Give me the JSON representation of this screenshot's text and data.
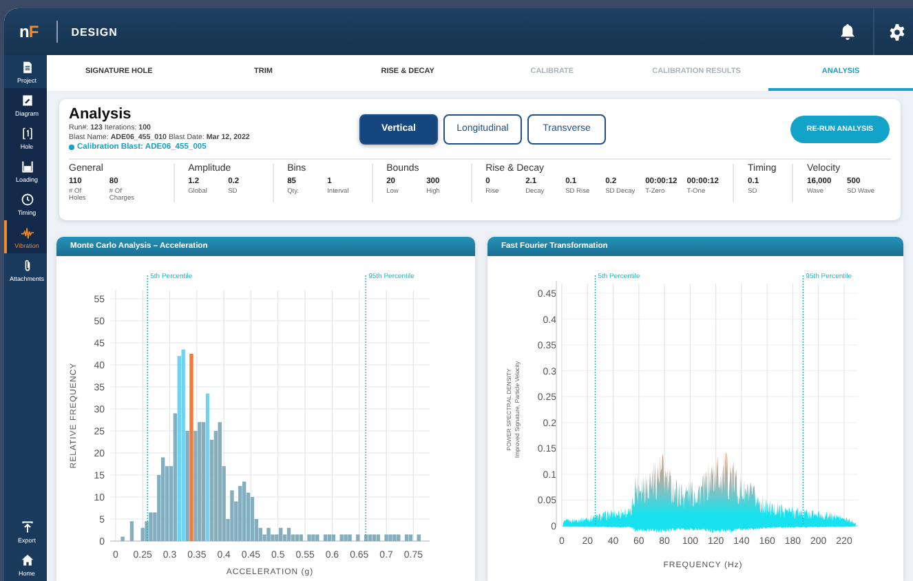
{
  "header": {
    "logo_left": "n",
    "logo_right": "F",
    "title": "DESIGN"
  },
  "sidebar": {
    "items": [
      {
        "label": "Project",
        "kind": "section",
        "selected": false
      },
      {
        "label": "Diagram",
        "kind": "step",
        "selected": false
      },
      {
        "label": "Hole",
        "kind": "step",
        "selected": false
      },
      {
        "label": "Loading",
        "kind": "step",
        "selected": false
      },
      {
        "label": "Timing",
        "kind": "step",
        "selected": false
      },
      {
        "label": "Vibration",
        "kind": "step",
        "selected": true
      },
      {
        "label": "Attachments",
        "kind": "section",
        "selected": false
      }
    ],
    "footer_items": [
      {
        "label": "Export"
      },
      {
        "label": "Home"
      }
    ]
  },
  "tabs": [
    {
      "label": "SIGNATURE HOLE",
      "selected": false,
      "disabled": false
    },
    {
      "label": "TRIM",
      "selected": false,
      "disabled": false
    },
    {
      "label": "RISE & DECAY",
      "selected": false,
      "disabled": false
    },
    {
      "label": "CALIBRATE",
      "selected": false,
      "disabled": true
    },
    {
      "label": "CALIBRATION RESULTS",
      "selected": false,
      "disabled": true
    },
    {
      "label": "ANALYSIS",
      "selected": true,
      "disabled": false
    }
  ],
  "analysis": {
    "title": "Analysis",
    "run_line": "Run#: **123** Iterations: **100**",
    "blast_line": "Blast Name: **ADE06_455_010** Blast Date: **Mar 12, 2022**",
    "calibration": "Calibration Blast: ADE06_455_005",
    "orientations": [
      {
        "label": "Vertical",
        "selected": true
      },
      {
        "label": "Longitudinal",
        "selected": false
      },
      {
        "label": "Transverse",
        "selected": false
      }
    ],
    "action": "RE-RUN ANALYSIS",
    "stats": [
      {
        "title": "General",
        "items": [
          {
            "value": "110",
            "label": "# Of Holes"
          },
          {
            "value": "80",
            "label": "# Of Charges"
          }
        ]
      },
      {
        "title": "Amplitude",
        "items": [
          {
            "value": "1.2",
            "label": "Global"
          },
          {
            "value": "0.2",
            "label": "SD"
          }
        ]
      },
      {
        "title": "Bins",
        "items": [
          {
            "value": "85",
            "label": "Qty."
          },
          {
            "value": "1",
            "label": "Interval"
          }
        ]
      },
      {
        "title": "Bounds",
        "items": [
          {
            "value": "20",
            "label": "Low"
          },
          {
            "value": "300",
            "label": "High"
          }
        ]
      },
      {
        "title": "Rise & Decay",
        "items": [
          {
            "value": "0",
            "label": "Rise"
          },
          {
            "value": "2.1",
            "label": "Decay"
          },
          {
            "value": "0.1",
            "label": "SD Rise"
          },
          {
            "value": "0.2",
            "label": "SD Decay"
          },
          {
            "value": "00:00:12",
            "label": "T-Zero"
          },
          {
            "value": "00:00:12",
            "label": "T-One"
          }
        ]
      },
      {
        "title": "Timing",
        "items": [
          {
            "value": "0.1",
            "label": "SD"
          }
        ]
      },
      {
        "title": "Velocity",
        "items": [
          {
            "value": "16,000",
            "label": "Wave"
          },
          {
            "value": "500",
            "label": "SD Wave"
          }
        ]
      }
    ]
  },
  "histogram": {
    "title": "Monte Carlo Analysis – Acceleration",
    "chart_data": {
      "type": "bar",
      "xlabel": "ACCELERATION (g)",
      "ylabel": "RELATIVE FREQUENCY",
      "x": [
        0.213,
        0.23,
        0.25,
        0.2575,
        0.265,
        0.2725,
        0.28,
        0.2875,
        0.295,
        0.3025,
        0.31,
        0.3175,
        0.325,
        0.3325,
        0.34,
        0.3475,
        0.355,
        0.3625,
        0.37,
        0.3775,
        0.385,
        0.3925,
        0.4,
        0.4075,
        0.415,
        0.4225,
        0.43,
        0.4375,
        0.445,
        0.4525,
        0.46,
        0.4675,
        0.475,
        0.4825,
        0.49,
        0.4975,
        0.505,
        0.5125,
        0.52,
        0.5275,
        0.535,
        0.5425,
        0.55,
        0.5575,
        0.565,
        0.5725,
        0.58,
        0.5875,
        0.595,
        0.6025,
        0.61,
        0.6175,
        0.625,
        0.6325,
        0.64,
        0.6475,
        0.655,
        0.6625,
        0.67,
        0.6775,
        0.685,
        0.6925,
        0.7,
        0.7075,
        0.715,
        0.7225,
        0.73,
        0.7375,
        0.745,
        0.7525,
        0.76
      ],
      "series": [
        {
          "color": "#84aebd",
          "values": [
            1,
            4.5,
            3,
            4.5,
            6.5,
            6.5,
            15,
            19,
            17,
            17,
            29,
            null,
            null,
            25,
            null,
            25,
            27,
            27,
            null,
            23,
            25,
            27,
            17,
            5,
            11.5,
            9,
            12.5,
            13.5,
            11,
            10,
            5,
            3,
            1.5,
            3,
            1.5,
            1.5,
            3,
            1.5,
            3,
            1.5,
            1.5,
            1.5,
            null,
            1.5,
            1.5,
            1.5,
            null,
            1.5,
            1.5,
            1.5,
            null,
            1.5,
            1.5,
            1.5,
            null,
            1.5,
            null,
            1.5,
            1.5,
            1.5,
            1.5,
            null,
            1.5,
            1.5,
            1.5,
            1.5,
            null,
            1.5,
            1.5,
            null,
            1.5
          ]
        },
        {
          "color": "#6fd3ef",
          "values": [
            null,
            null,
            null,
            null,
            null,
            null,
            null,
            null,
            null,
            null,
            null,
            42,
            43.5,
            null,
            null,
            null,
            null,
            null,
            33.5,
            null,
            null,
            null,
            null,
            null,
            null,
            null,
            null,
            null,
            null,
            null,
            null,
            null,
            null,
            null,
            null,
            null,
            null,
            null,
            null,
            null,
            null,
            null,
            null,
            null,
            null,
            null,
            null,
            null,
            null,
            null,
            null,
            null,
            null,
            null,
            null,
            null,
            null,
            null,
            null,
            null,
            null,
            null,
            null,
            null,
            null,
            null,
            null,
            null,
            null,
            null,
            null
          ]
        },
        {
          "color": "#f07a3a",
          "values": [
            null,
            null,
            null,
            null,
            null,
            null,
            null,
            null,
            null,
            null,
            null,
            null,
            null,
            null,
            42.5,
            null,
            null,
            null,
            null,
            null,
            null,
            null,
            null,
            null,
            null,
            null,
            null,
            null,
            null,
            null,
            null,
            null,
            null,
            null,
            null,
            null,
            null,
            null,
            null,
            null,
            null,
            null,
            null,
            null,
            null,
            null,
            null,
            null,
            null,
            null,
            null,
            null,
            null,
            null,
            null,
            null,
            null,
            null,
            null,
            null,
            null,
            null,
            null,
            null,
            null,
            null,
            null,
            null,
            null,
            null,
            null
          ]
        }
      ],
      "stacked": false,
      "grid": true,
      "xlim": [
        0.19,
        0.78
      ],
      "ylim": [
        0,
        57
      ],
      "xticks": [
        {
          "value": 0.2,
          "label": "0"
        },
        0.25,
        0.3,
        0.35,
        0.4,
        0.45,
        0.5,
        0.55,
        0.6,
        0.65,
        0.7,
        0.75
      ],
      "yticks": [
        0,
        5,
        10,
        15,
        20,
        25,
        30,
        35,
        40,
        45,
        50,
        55
      ],
      "ref_lines": [
        {
          "axis": "x",
          "value": 0.259,
          "label": "5th Percentile"
        },
        {
          "axis": "x",
          "value": 0.662,
          "label": "95th Percentile"
        }
      ]
    }
  },
  "fft": {
    "title": "Fast Fourier Transformation",
    "ylabel": "POWER SPECTRAL DENSITY",
    "ylabel_sub": "Improved Signature, Particle Velocity",
    "xlabel": "FREQUENCY (Hz)",
    "y_tick_labels": [
      "0.45",
      "0.4",
      "0.35",
      "0.3",
      "0.25",
      "0.2",
      "0.15",
      "0.1",
      "0.05",
      "0"
    ],
    "x_tick_labels": [
      "0",
      "20",
      "40",
      "60",
      "80",
      "100",
      "120",
      "140",
      "160",
      "180",
      "200",
      "220"
    ],
    "markers": [
      {
        "label": "5th Percentile"
      },
      {
        "label": "95th Percentile"
      }
    ]
  }
}
